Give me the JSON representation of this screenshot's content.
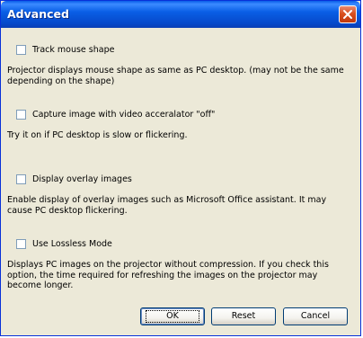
{
  "window": {
    "title": "Advanced",
    "close_icon": "close-x-icon"
  },
  "options": [
    {
      "label": "Track mouse shape",
      "checked": false,
      "description": "Projector displays mouse shape as same as PC desktop. (may not be the same depending on the shape)"
    },
    {
      "label": "Capture image with video acceralator \"off\"",
      "checked": false,
      "description": "Try it on if PC desktop is slow or flickering."
    },
    {
      "label": "Display overlay images",
      "checked": false,
      "description": "Enable display of overlay images such as Microsoft Office assistant. It may cause PC desktop flickering."
    },
    {
      "label": "Use Lossless Mode",
      "checked": false,
      "description": "Displays PC images on the projector without compression. If you check this option, the time required for refreshing the images on the projector may become longer."
    }
  ],
  "buttons": {
    "ok": "OK",
    "reset": "Reset",
    "cancel": "Cancel"
  },
  "colors": {
    "titlebar": "#0a5ce8",
    "close": "#d9501f",
    "face": "#ece9d8"
  }
}
